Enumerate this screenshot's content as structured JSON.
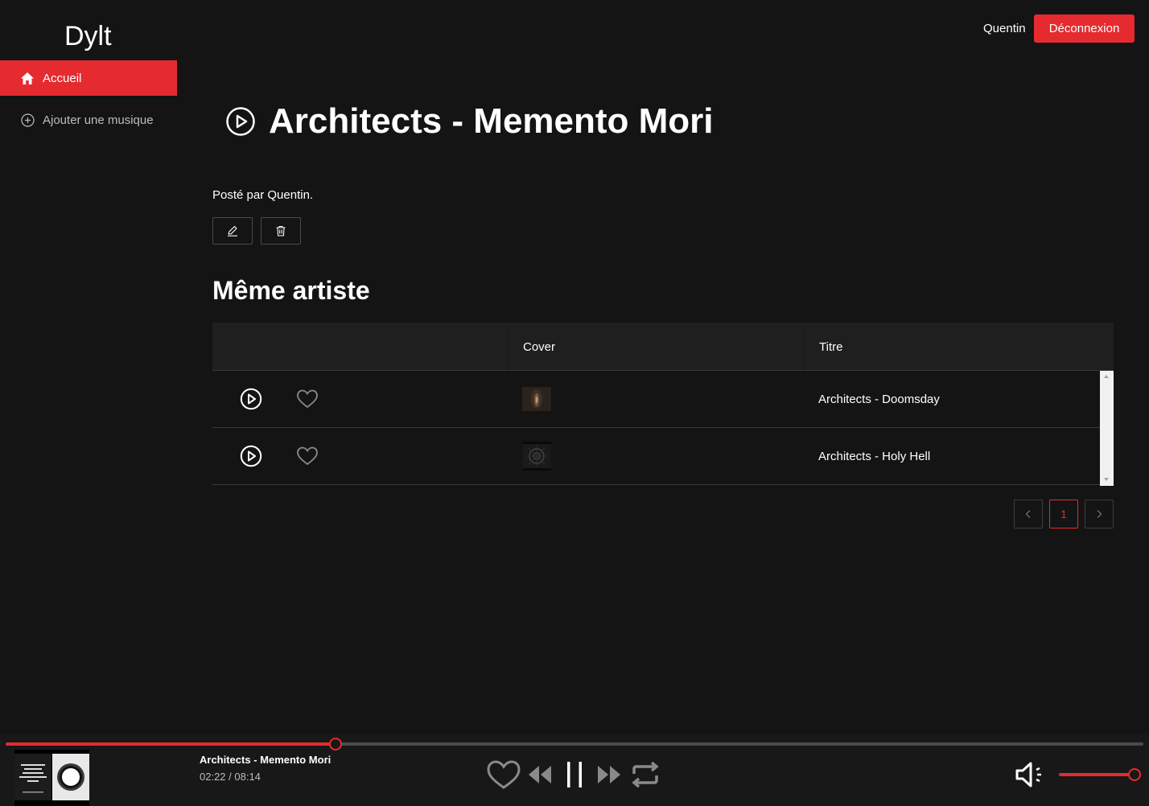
{
  "app": {
    "logo": "Dylt"
  },
  "sidebar": {
    "items": [
      {
        "label": "Accueil",
        "icon": "home-icon",
        "active": true
      },
      {
        "label": "Ajouter une musique",
        "icon": "plus-circle-icon",
        "active": false
      }
    ]
  },
  "header": {
    "user": "Quentin",
    "logout_label": "Déconnexion"
  },
  "song": {
    "title": "Architects - Memento Mori",
    "posted_by": "Posté par Quentin."
  },
  "same_artist": {
    "heading": "Même artiste",
    "columns": [
      "",
      "Cover",
      "Titre"
    ],
    "rows": [
      {
        "title": "Architects - Doomsday"
      },
      {
        "title": "Architects - Holy Hell"
      }
    ]
  },
  "pagination": {
    "current_page": "1"
  },
  "player": {
    "track_title": "Architects - Memento Mori",
    "time": "02:22 / 08:14",
    "progress_fraction": 0.29,
    "volume_fraction": 1.0
  },
  "colors": {
    "accent": "#e52b2f",
    "background": "#141414",
    "player_bg": "#181818"
  }
}
